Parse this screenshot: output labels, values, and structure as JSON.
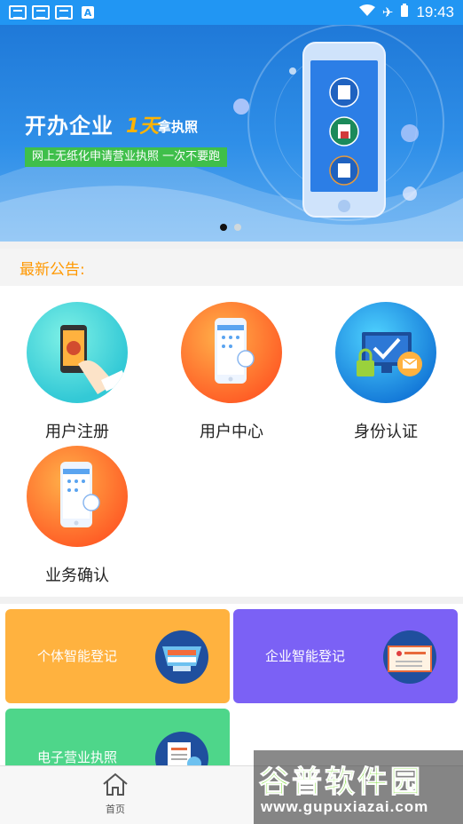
{
  "status_bar": {
    "time": "19:43"
  },
  "banner": {
    "title": "开办企业",
    "days": "1天",
    "subtitle": "拿执照",
    "tag": "网上无纸化申请营业执照  一次不要跑"
  },
  "notice": {
    "label": "最新公告:"
  },
  "grid": {
    "items": [
      {
        "label": "用户注册",
        "icon": "user-register-icon",
        "color": "#33c9d6"
      },
      {
        "label": "用户中心",
        "icon": "user-center-icon",
        "color": "#ff5e26"
      },
      {
        "label": "身份认证",
        "icon": "identity-verify-icon",
        "color": "#1479d8"
      },
      {
        "label": "业务确认",
        "icon": "business-confirm-icon",
        "color": "#ff5e26"
      }
    ]
  },
  "cards": [
    {
      "label": "个体智能登记",
      "color": "#ffb23f"
    },
    {
      "label": "企业智能登记",
      "color": "#7b61f5"
    },
    {
      "label": "电子营业执照",
      "color": "#4ed68a"
    }
  ],
  "bottom_nav": {
    "home_label": "首页"
  },
  "watermark": {
    "line1": "谷普软件园",
    "line2": "www.gupuxiazai.com"
  }
}
